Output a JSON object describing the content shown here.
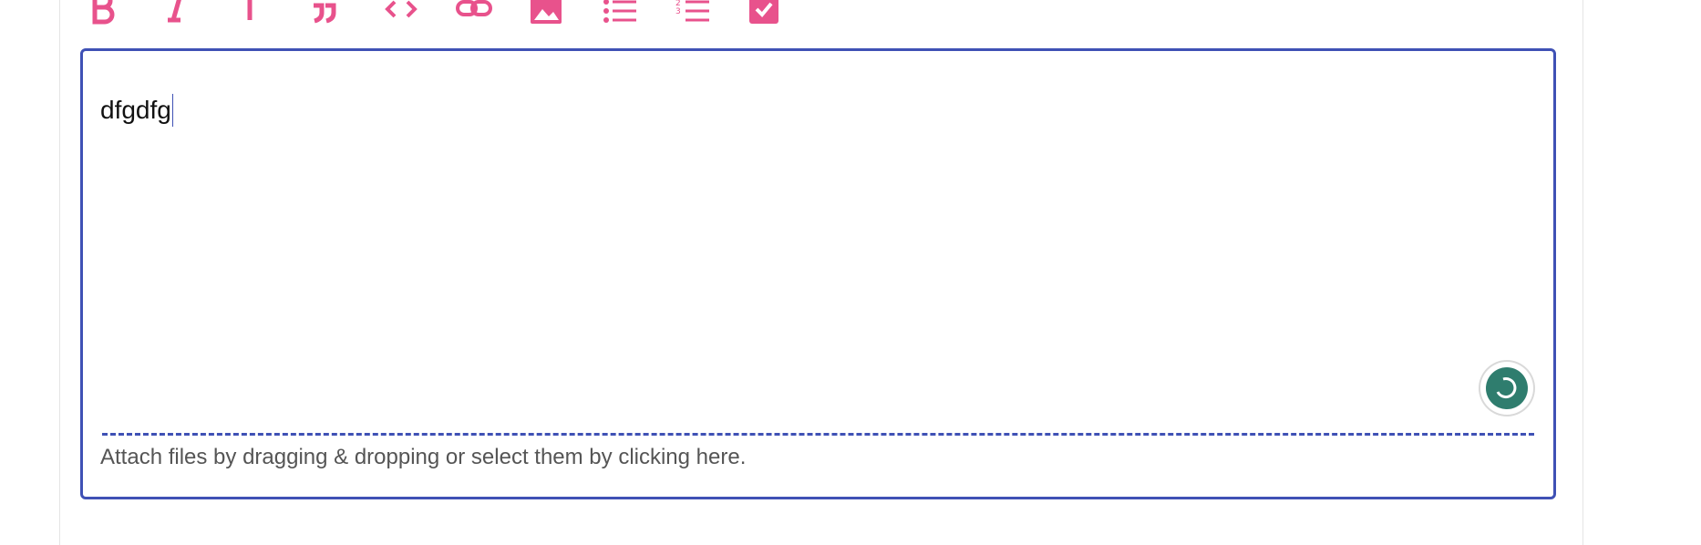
{
  "colors": {
    "accent": "#e8528c",
    "focus_border": "#3f51b5",
    "grammar_badge": "#2f7d6e",
    "text": "#111111",
    "muted_text": "#555555"
  },
  "toolbar": {
    "buttons": [
      {
        "name": "bold",
        "icon": "bold-icon"
      },
      {
        "name": "italic",
        "icon": "italic-icon"
      },
      {
        "name": "heading",
        "icon": "heading-icon"
      },
      {
        "name": "quote",
        "icon": "quote-icon"
      },
      {
        "name": "code",
        "icon": "code-icon"
      },
      {
        "name": "link",
        "icon": "link-icon"
      },
      {
        "name": "image",
        "icon": "image-icon"
      },
      {
        "name": "bullet-list",
        "icon": "bullet-list-icon"
      },
      {
        "name": "numbered-list",
        "icon": "numbered-list-icon"
      },
      {
        "name": "task-list",
        "icon": "checkbox-icon"
      }
    ]
  },
  "editor": {
    "value": "dfgdfg",
    "attach_hint": "Attach files by dragging & dropping or select them by clicking here.",
    "grammar_icon": "grammar-check-icon"
  }
}
